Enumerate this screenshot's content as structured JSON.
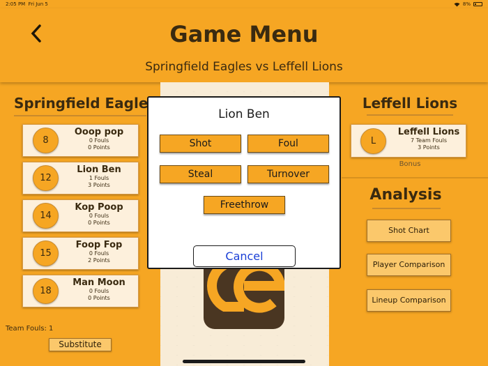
{
  "status": {
    "time": "2:05 PM",
    "date": "Fri Jun 5",
    "battery": "8%"
  },
  "header": {
    "title": "Game Menu",
    "subtitle": "Springfield Eagles vs Leffell Lions"
  },
  "home_team": {
    "name": "Springfield Eagles",
    "players": [
      {
        "number": "8",
        "name": "Ooop pop",
        "fouls": "0 Fouls",
        "points": "0 Points"
      },
      {
        "number": "12",
        "name": "Lion Ben",
        "fouls": "1 Fouls",
        "points": "3 Points"
      },
      {
        "number": "14",
        "name": "Kop Poop",
        "fouls": "0 Fouls",
        "points": "0 Points"
      },
      {
        "number": "15",
        "name": "Foop Fop",
        "fouls": "0 Fouls",
        "points": "2 Points"
      },
      {
        "number": "18",
        "name": "Man Moon",
        "fouls": "0 Fouls",
        "points": "0 Points"
      }
    ],
    "team_fouls": "Team Fouls: 1",
    "substitute_label": "Substitute"
  },
  "away_team": {
    "name": "Leffell Lions",
    "badge": "L",
    "card_name": "Leffell Lions",
    "team_fouls": "7 Team Fouls",
    "points": "3 Points",
    "bonus": "Bonus"
  },
  "analysis": {
    "title": "Analysis",
    "buttons": [
      "Shot Chart",
      "Player Comparison",
      "Lineup Comparison"
    ]
  },
  "modal": {
    "title": "Lion Ben",
    "shot": "Shot",
    "foul": "Foul",
    "steal": "Steal",
    "turnover": "Turnover",
    "freethrow": "Freethrow",
    "cancel": "Cancel"
  },
  "colors": {
    "accent": "#f6a623",
    "panel": "#fdf0dc",
    "cancel_text": "#1a3fd6"
  }
}
